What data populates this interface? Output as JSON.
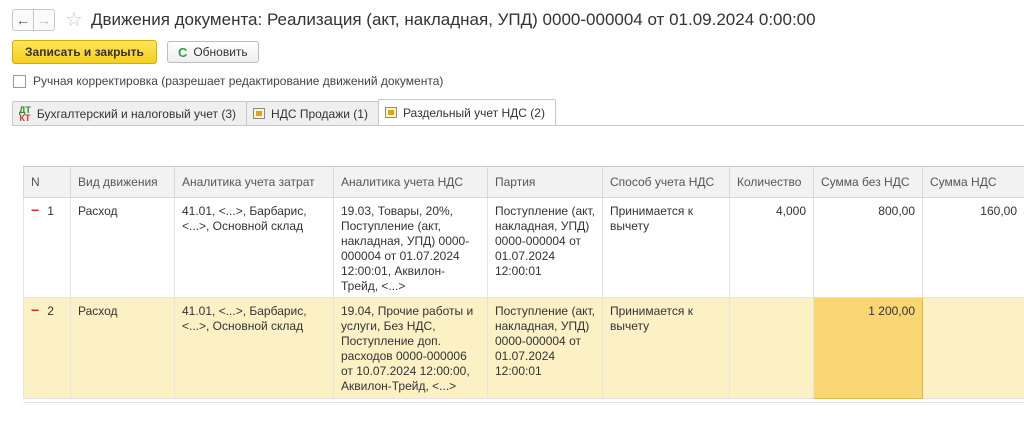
{
  "window": {
    "title": "Движения документа: Реализация (акт, накладная, УПД) 0000-000004 от 01.09.2024 0:00:00",
    "back_glyph": "←",
    "forward_glyph": "→",
    "star_glyph": "☆"
  },
  "toolbar": {
    "save_close_label": "Записать и закрыть",
    "refresh_label": "Обновить",
    "refresh_glyph": "C"
  },
  "manual_correction": {
    "label": "Ручная корректировка (разрешает редактирование движений документа)",
    "checked": false
  },
  "tabs": [
    {
      "label": "Бухгалтерский и налоговый учет (3)",
      "icon": "dt-kt-icon",
      "icon_top": "ДТ",
      "icon_bottom": "КТ",
      "active": false
    },
    {
      "label": "НДС Продажи (1)",
      "icon": "register-icon",
      "active": false
    },
    {
      "label": "Раздельный учет НДС (2)",
      "icon": "register-icon",
      "active": true
    }
  ],
  "table": {
    "columns": [
      "N",
      "Вид движения",
      "Аналитика учета затрат",
      "Аналитика учета НДС",
      "Партия",
      "Способ учета НДС",
      "Количество",
      "Сумма без НДС",
      "Сумма НДС"
    ],
    "rows": [
      {
        "marker": "−",
        "n": "1",
        "movement": "Расход",
        "cost_analytics": "41.01, <...>, Барбарис, <...>, Основной склад",
        "vat_analytics": "19.03, Товары, 20%, Поступление (акт, накладная, УПД) 0000-000004 от 01.07.2024 12:00:01, Аквилон-Трейд, <...>",
        "batch": "Поступление (акт, накладная, УПД) 0000-000004 от 01.07.2024 12:00:01",
        "vat_method": "Принимается к вычету",
        "quantity": "4,000",
        "amount_without_vat": "800,00",
        "vat_amount": "160,00"
      },
      {
        "marker": "−",
        "n": "2",
        "movement": "Расход",
        "cost_analytics": "41.01, <...>, Барбарис, <...>, Основной склад",
        "vat_analytics": "19.04, Прочие работы и услуги, Без НДС, Поступление доп. расходов 0000-000006 от 10.07.2024 12:00:00, Аквилон-Трейд, <...>",
        "batch": "Поступление (акт, накладная, УПД) 0000-000004 от 01.07.2024 12:00:01",
        "vat_method": "Принимается к вычету",
        "quantity": "",
        "amount_without_vat": "1 200,00",
        "vat_amount": ""
      }
    ]
  },
  "colors": {
    "primary_button": "#f5cf1e",
    "selected_row": "#fbf1c4",
    "selected_cell": "#f9d672",
    "minus_marker": "#d8262c"
  }
}
